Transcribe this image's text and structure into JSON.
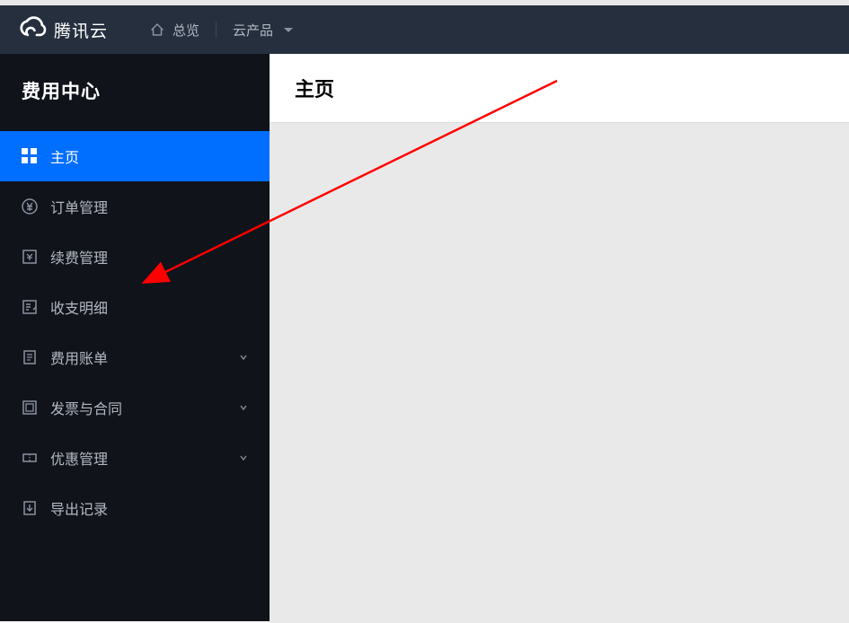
{
  "header": {
    "brand": "腾讯云",
    "nav_overview": "总览",
    "nav_products": "云产品"
  },
  "sidebar": {
    "title": "费用中心",
    "items": [
      {
        "label": "主页",
        "icon": "home-grid",
        "active": true,
        "expandable": false
      },
      {
        "label": "订单管理",
        "icon": "yen-circle",
        "active": false,
        "expandable": false
      },
      {
        "label": "续费管理",
        "icon": "renewal",
        "active": false,
        "expandable": false
      },
      {
        "label": "收支明细",
        "icon": "receipt",
        "active": false,
        "expandable": false
      },
      {
        "label": "费用账单",
        "icon": "bill",
        "active": false,
        "expandable": true
      },
      {
        "label": "发票与合同",
        "icon": "invoice",
        "active": false,
        "expandable": true
      },
      {
        "label": "优惠管理",
        "icon": "coupon",
        "active": false,
        "expandable": true
      },
      {
        "label": "导出记录",
        "icon": "export",
        "active": false,
        "expandable": false
      }
    ]
  },
  "main": {
    "page_title": "主页"
  },
  "annotation": {
    "arrow_target": "续费管理"
  }
}
